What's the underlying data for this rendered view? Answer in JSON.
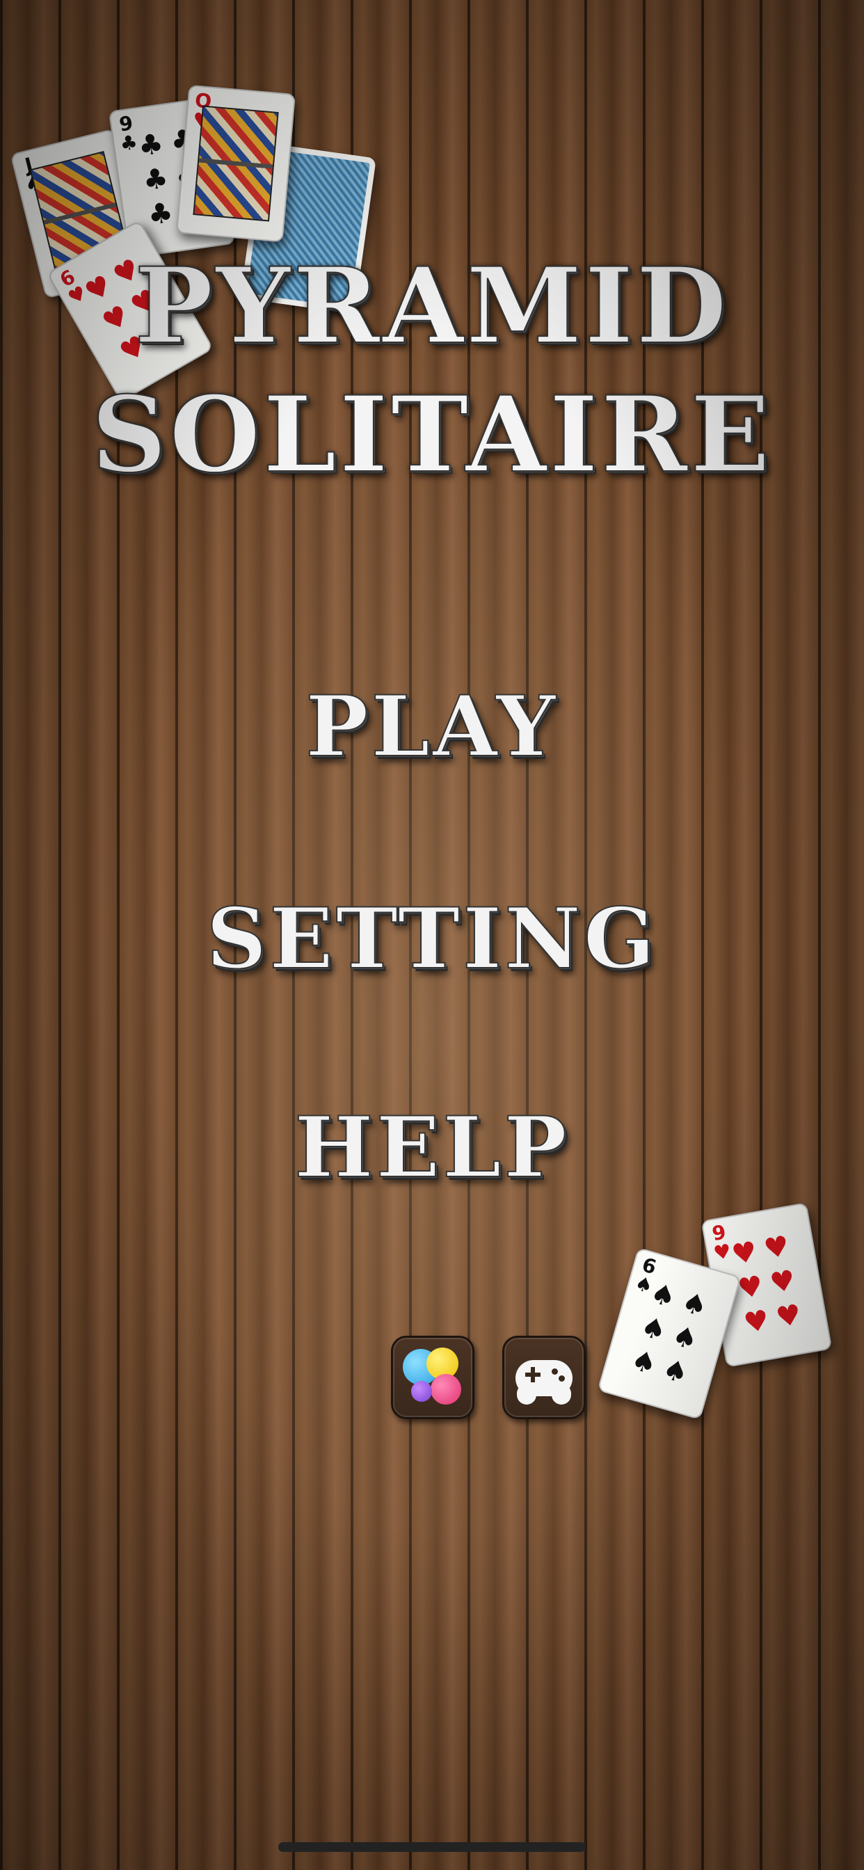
{
  "title": {
    "line1": "PYRAMID",
    "line2": "SOLITAIRE"
  },
  "menu": {
    "play": "PLAY",
    "setting": "SETTING",
    "help": "HELP"
  },
  "cards_top": {
    "jack_rank": "J",
    "jack_suit": "♠",
    "nine_rank": "9",
    "nine_suit": "♣",
    "queen_rank": "Q",
    "queen_suit": "♥",
    "six_hearts_rank": "6",
    "six_hearts_suit": "♥"
  },
  "cards_bottom": {
    "six_spades_rank": "6",
    "six_spades_suit": "♠",
    "nine_hearts_rank": "9",
    "nine_hearts_suit": "♥"
  },
  "icons": {
    "game_center": "game-center-icon",
    "controller": "gamepad-icon"
  },
  "colors": {
    "title_text": "#f4f4f4",
    "wood_dark": "#5e3b22",
    "wood_light": "#84593a",
    "card_red": "#d5141c"
  }
}
